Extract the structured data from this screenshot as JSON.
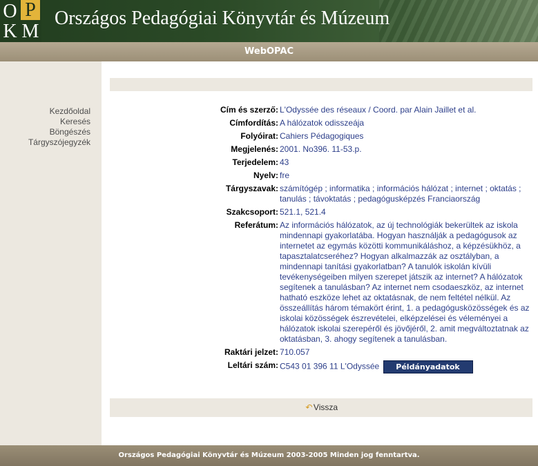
{
  "header": {
    "logo_letters": [
      "O",
      "P",
      "K",
      "M"
    ],
    "title": "Országos Pedagógiai Könyvtár és Múzeum"
  },
  "subbar": {
    "title": "WebOPAC"
  },
  "sidebar": {
    "items": [
      {
        "label": "Kezdőoldal"
      },
      {
        "label": "Keresés"
      },
      {
        "label": "Böngészés"
      },
      {
        "label": "Tárgyszójegyzék"
      }
    ]
  },
  "record": {
    "fields": [
      {
        "label": "Cím és szerző:",
        "value": "L'Odyssée des réseaux / Coord. par Alain Jaillet et al."
      },
      {
        "label": "Címfordítás:",
        "value": "A hálózatok odisszeája"
      },
      {
        "label": "Folyóirat:",
        "value": "Cahiers Pédagogiques"
      },
      {
        "label": "Megjelenés:",
        "value": "2001. No396. 11-53.p."
      },
      {
        "label": "Terjedelem:",
        "value": "43"
      },
      {
        "label": "Nyelv:",
        "value": "fre"
      },
      {
        "label": "Tárgyszavak:",
        "value": "számítógép ; informatika ; információs hálózat ; internet ; oktatás ; tanulás ; távoktatás ; pedagógusképzés Franciaország"
      },
      {
        "label": "Szakcsoport:",
        "value": "521.1, 521.4"
      },
      {
        "label": "Referátum:",
        "value": "Az információs hálózatok, az új technológiák bekerültek az iskola mindennapi gyakorlatába. Hogyan használják a pedagógusok az internetet az egymás közötti kommunikáláshoz, a képzésükhöz, a tapasztalatcseréhez? Hogyan alkalmazzák az osztályban, a mindennapi tanítási gyakorlatban? A tanulók iskolán kívüli tevékenységeiben milyen szerepet játszik az internet? A hálózatok segítenek a tanulásban? Az internet nem csodaeszköz, az internet hatható eszköze lehet az oktatásnak, de nem feltétel nélkül. Az összeállítás három témakört érint, 1. a pedagógusközösségek és az iskolai közösségek észrevételei, elképzelései és véleményei a hálózatok iskolai szerepéről és jövőjéről, 2. amit megváltoztatnak az oktatásban, 3. ahogy segítenek a tanulásban."
      },
      {
        "label": "Raktári jelzet:",
        "value": "710.057"
      },
      {
        "label": "Leltári szám:",
        "value": "C543 01 396 11 L'Odyssée"
      }
    ],
    "copies_button": "Példányadatok"
  },
  "back": {
    "label": "Vissza"
  },
  "footer": {
    "text": "Országos Pedagógiai Könyvtár és Múzeum 2003-2005 Minden jog fenntartva."
  },
  "colors": {
    "header_green": "#2b4a27",
    "logo_gold": "#e3b43a",
    "bar_tan": "#9c8f77",
    "panel_beige": "#ece8e0",
    "link_blue": "#2d3f8a",
    "button_navy": "#233b70"
  }
}
